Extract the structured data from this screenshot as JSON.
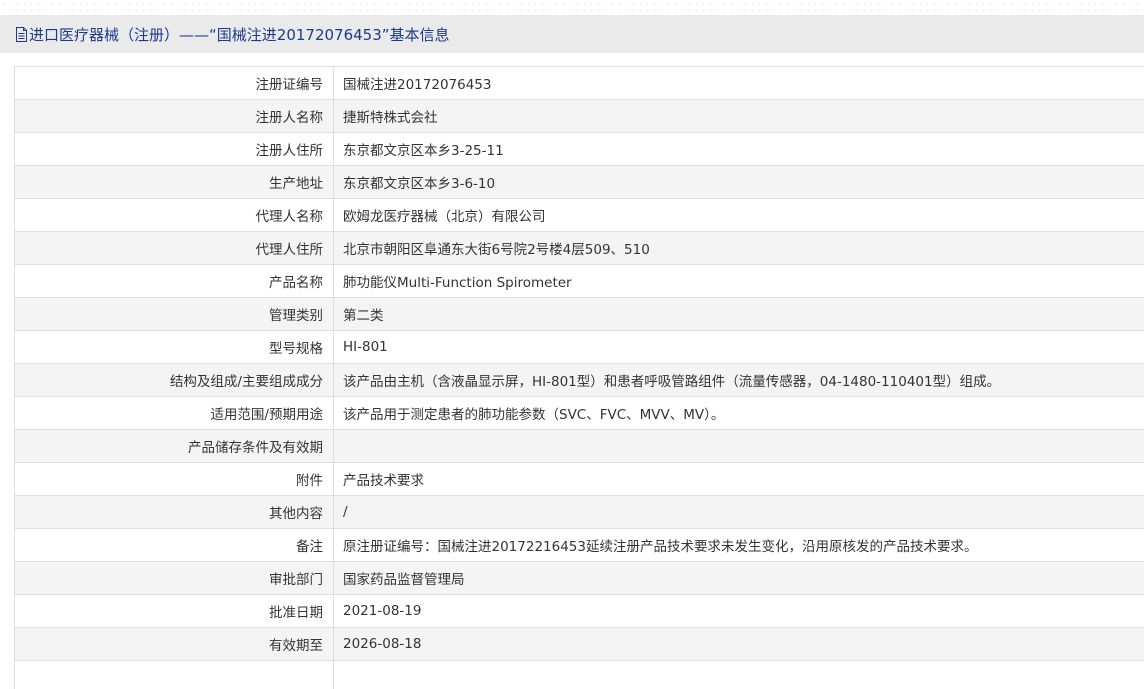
{
  "header": {
    "title": "进口医疗器械（注册）——“国械注进20172076453”基本信息",
    "icon": "document-icon"
  },
  "rows": [
    {
      "label": "注册证编号",
      "value": "国械注进20172076453"
    },
    {
      "label": "注册人名称",
      "value": "捷斯特株式会社"
    },
    {
      "label": "注册人住所",
      "value": "东京都文京区本乡3-25-11"
    },
    {
      "label": "生产地址",
      "value": "东京都文京区本乡3-6-10"
    },
    {
      "label": "代理人名称",
      "value": "欧姆龙医疗器械（北京）有限公司"
    },
    {
      "label": "代理人住所",
      "value": "北京市朝阳区阜通东大街6号院2号楼4层509、510"
    },
    {
      "label": "产品名称",
      "value": "肺功能仪Multi-Function Spirometer"
    },
    {
      "label": "管理类别",
      "value": "第二类"
    },
    {
      "label": "型号规格",
      "value": "HI-801"
    },
    {
      "label": "结构及组成/主要组成成分",
      "value": "该产品由主机（含液晶显示屏，HI-801型）和患者呼吸管路组件（流量传感器，04-1480-110401型）组成。"
    },
    {
      "label": "适用范围/预期用途",
      "value": "该产品用于测定患者的肺功能参数（SVC、FVC、MVV、MV）。"
    },
    {
      "label": "产品储存条件及有效期",
      "value": ""
    },
    {
      "label": "附件",
      "value": "产品技术要求"
    },
    {
      "label": "其他内容",
      "value": "/"
    },
    {
      "label": "备注",
      "value": "原注册证编号：国械注进20172216453延续注册产品技术要求未发生变化，沿用原核发的产品技术要求。"
    },
    {
      "label": "审批部门",
      "value": "国家药品监督管理局"
    },
    {
      "label": "批准日期",
      "value": "2021-08-19"
    },
    {
      "label": "有效期至",
      "value": "2026-08-18"
    },
    {
      "label": "",
      "value": ""
    }
  ]
}
